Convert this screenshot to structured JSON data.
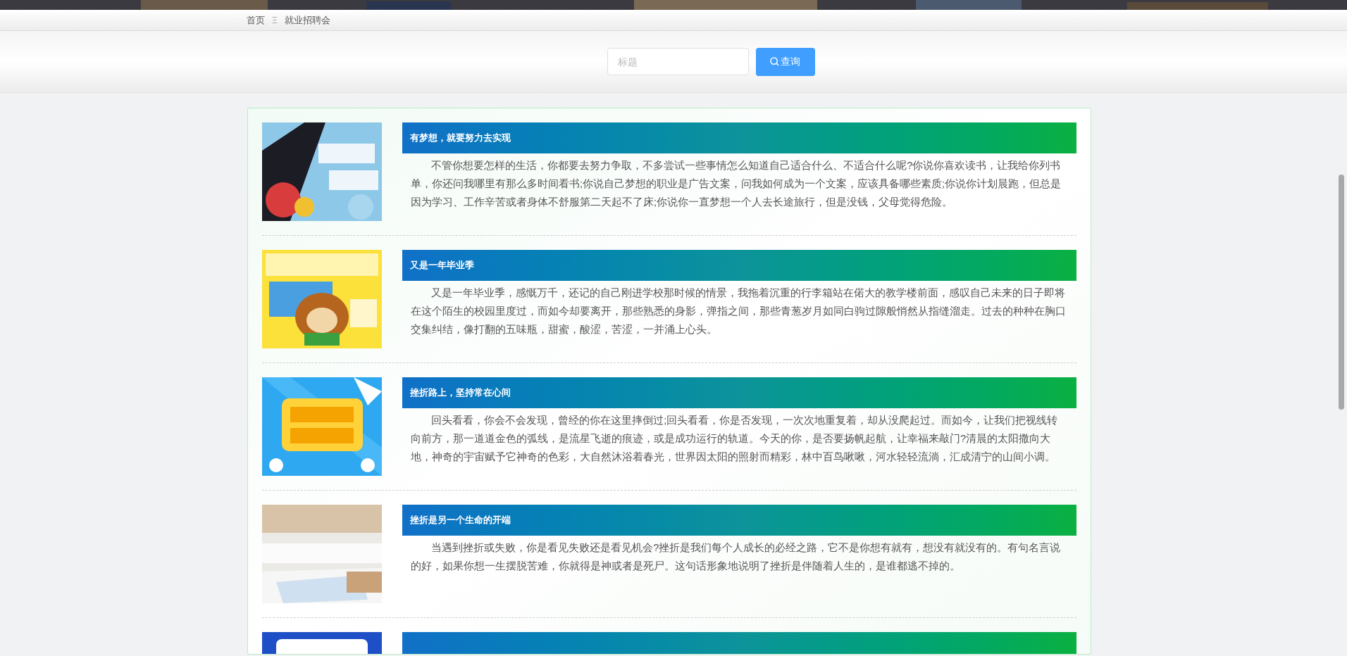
{
  "breadcrumb": {
    "items": [
      "首页",
      "就业招聘会"
    ],
    "separator": "Ξ"
  },
  "search": {
    "placeholder": "标题",
    "button": "查询"
  },
  "items": [
    {
      "kind": "full",
      "title": "有梦想，就要努力去实现",
      "body": "不管你想要怎样的生活，你都要去努力争取，不多尝试一些事情怎么知道自己适合什么、不适合什么呢?你说你喜欢读书，让我给你列书单，你还问我哪里有那么多时间看书;你说自己梦想的职业是广告文案，问我如何成为一个文案，应该具备哪些素质;你说你计划晨跑，但总是因为学习、工作辛苦或者身体不舒服第二天起不了床;你说你一直梦想一个人去长途旅行，但是没钱，父母觉得危险。"
    },
    {
      "kind": "full",
      "title": "又是一年毕业季",
      "body": "又是一年毕业季，感慨万千，还记的自己刚进学校那时候的情景，我拖着沉重的行李箱站在偌大的教学楼前面，感叹自己未来的日子即将在这个陌生的校园里度过，而如今却要离开，那些熟悉的身影，弹指之间，那些青葱岁月如同白驹过隙般悄然从指缝溜走。过去的种种在胸口交集纠结，像打翻的五味瓶，甜蜜，酸涩，苦涩，一并涌上心头。"
    },
    {
      "kind": "full",
      "title": "挫折路上，坚持常在心间",
      "body": "回头看看，你会不会发现，曾经的你在这里摔倒过;回头看看，你是否发现，一次次地重复着，却从没爬起过。而如今，让我们把视线转向前方，那一道道金色的弧线，是流星飞逝的痕迹，或是成功运行的轨道。今天的你，是否要扬帆起航，让幸福来敲门?清晨的太阳撒向大地，神奇的宇宙赋予它神奇的色彩，大自然沐浴着春光，世界因太阳的照射而精彩，林中百鸟啾啾，河水轻轻流淌，汇成清宁的山间小调。"
    },
    {
      "kind": "full",
      "title": "挫折是另一个生命的开端",
      "body": "当遇到挫折或失败，你是看见失败还是看见机会?挫折是我们每个人成长的必经之路，它不是你想有就有，想没有就没有的。有句名言说的好，如果你想一生摆脱苦难，你就得是神或者是死尸。这句话形象地说明了挫折是伴随着人生的，是谁都逃不掉的。"
    },
    {
      "kind": "cut"
    }
  ]
}
